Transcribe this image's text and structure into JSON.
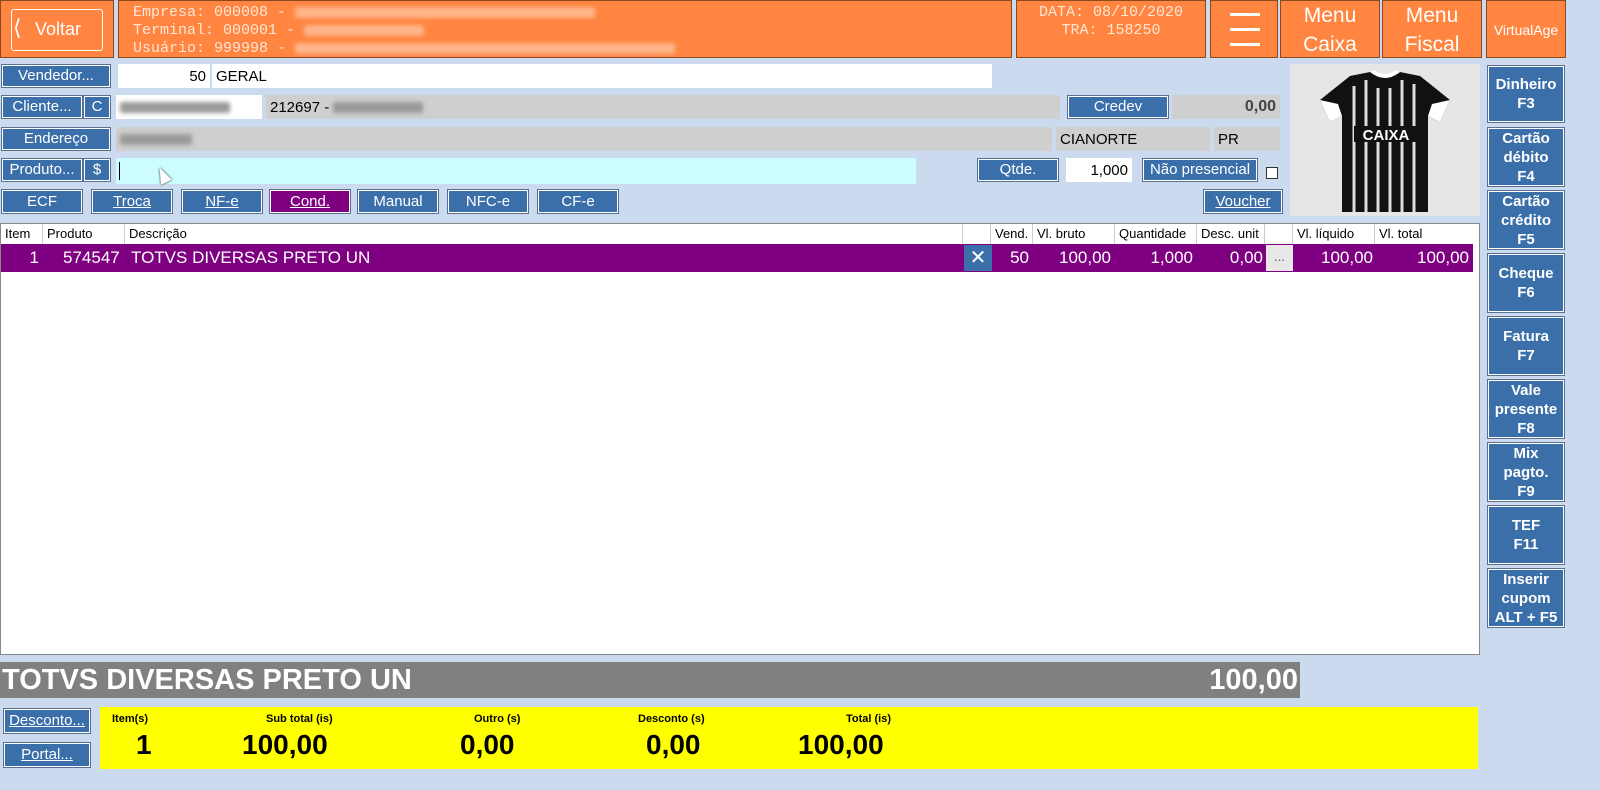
{
  "header": {
    "back_label": "Voltar",
    "empresa_prefix": "Empresa: 000008 -",
    "terminal_prefix": "Terminal: 000001 -",
    "usuario_prefix": "Usuário: 999998 -",
    "data_text": "DATA: 08/10/2020",
    "tra_text": "TRA: 158250",
    "menu_caixa": [
      "Menu",
      "Caixa"
    ],
    "menu_fiscal": [
      "Menu",
      "Fiscal"
    ],
    "virtualage": "VirtualAge"
  },
  "form": {
    "vendedor_label": "Vendedor...",
    "vendedor_code": "50",
    "vendedor_name": "GERAL",
    "cliente_label": "Cliente...",
    "cliente_c": "C",
    "cliente_code": "212697 -",
    "credev_label": "Credev",
    "credev_value": "0,00",
    "endereco_label": "Endereço",
    "cidade": "CIANORTE",
    "uf": "PR",
    "produto_label": "Produto...",
    "produto_dollar": "$",
    "qtde_label": "Qtde.",
    "qtde_value": "1,000",
    "nao_presencial_label": "Não presencial"
  },
  "toolbar": {
    "ecf": "ECF",
    "troca": "Troca",
    "nfe": "NF-e",
    "cond": "Cond.",
    "manual": "Manual",
    "nfce": "NFC-e",
    "cfe": "CF-e",
    "voucher": "Voucher"
  },
  "grid": {
    "headers": {
      "item": "Item",
      "produto": "Produto",
      "descricao": "Descrição",
      "vend": "Vend.",
      "vl_bruto": "Vl. bruto",
      "quantidade": "Quantidade",
      "desc_unit": "Desc. unit",
      "vl_liquido": "Vl. líquido",
      "vl_total": "Vl. total"
    },
    "rows": [
      {
        "item": "1",
        "produto": "574547",
        "descricao": "TOTVS DIVERSAS PRETO UN",
        "vend": "50",
        "vl_bruto": "100,00",
        "quantidade": "1,000",
        "desc_unit": "0,00",
        "more": "...",
        "vl_liquido": "100,00",
        "vl_total": "100,00"
      }
    ]
  },
  "sidebar": {
    "buttons": [
      [
        "Dinheiro",
        "F3"
      ],
      [
        "Cartão",
        "débito",
        "F4"
      ],
      [
        "Cartão",
        "crédito",
        "F5"
      ],
      [
        "Cheque",
        "F6"
      ],
      [
        "Fatura",
        "F7"
      ],
      [
        "Vale",
        "presente",
        "F8"
      ],
      [
        "Mix",
        "pagto.",
        "F9"
      ],
      [
        "TEF",
        "F11"
      ],
      [
        "Inserir",
        "cupom",
        "ALT + F5"
      ]
    ]
  },
  "product_image": {
    "text": "CAIXA"
  },
  "footer": {
    "selected_desc": "TOTVS DIVERSAS PRETO UN",
    "selected_value": "100,00",
    "desconto_label": "Desconto...",
    "portal_label": "Portal...",
    "totals": {
      "itens_label": "Item(s)",
      "itens_value": "1",
      "subtotal_label": "Sub total (is)",
      "subtotal_value": "100,00",
      "outro_label": "Outro (s)",
      "outro_value": "0,00",
      "desconto_label": "Desconto (s)",
      "desconto_value": "0,00",
      "total_label": "Total (is)",
      "total_value": "100,00"
    }
  },
  "colors": {
    "header_orange": "#ff8540",
    "button_blue": "#3b6faa",
    "selected_row_purple": "#7e0080",
    "totals_yellow": "#ffff00",
    "produto_input_cyan": "#ccfcff"
  }
}
